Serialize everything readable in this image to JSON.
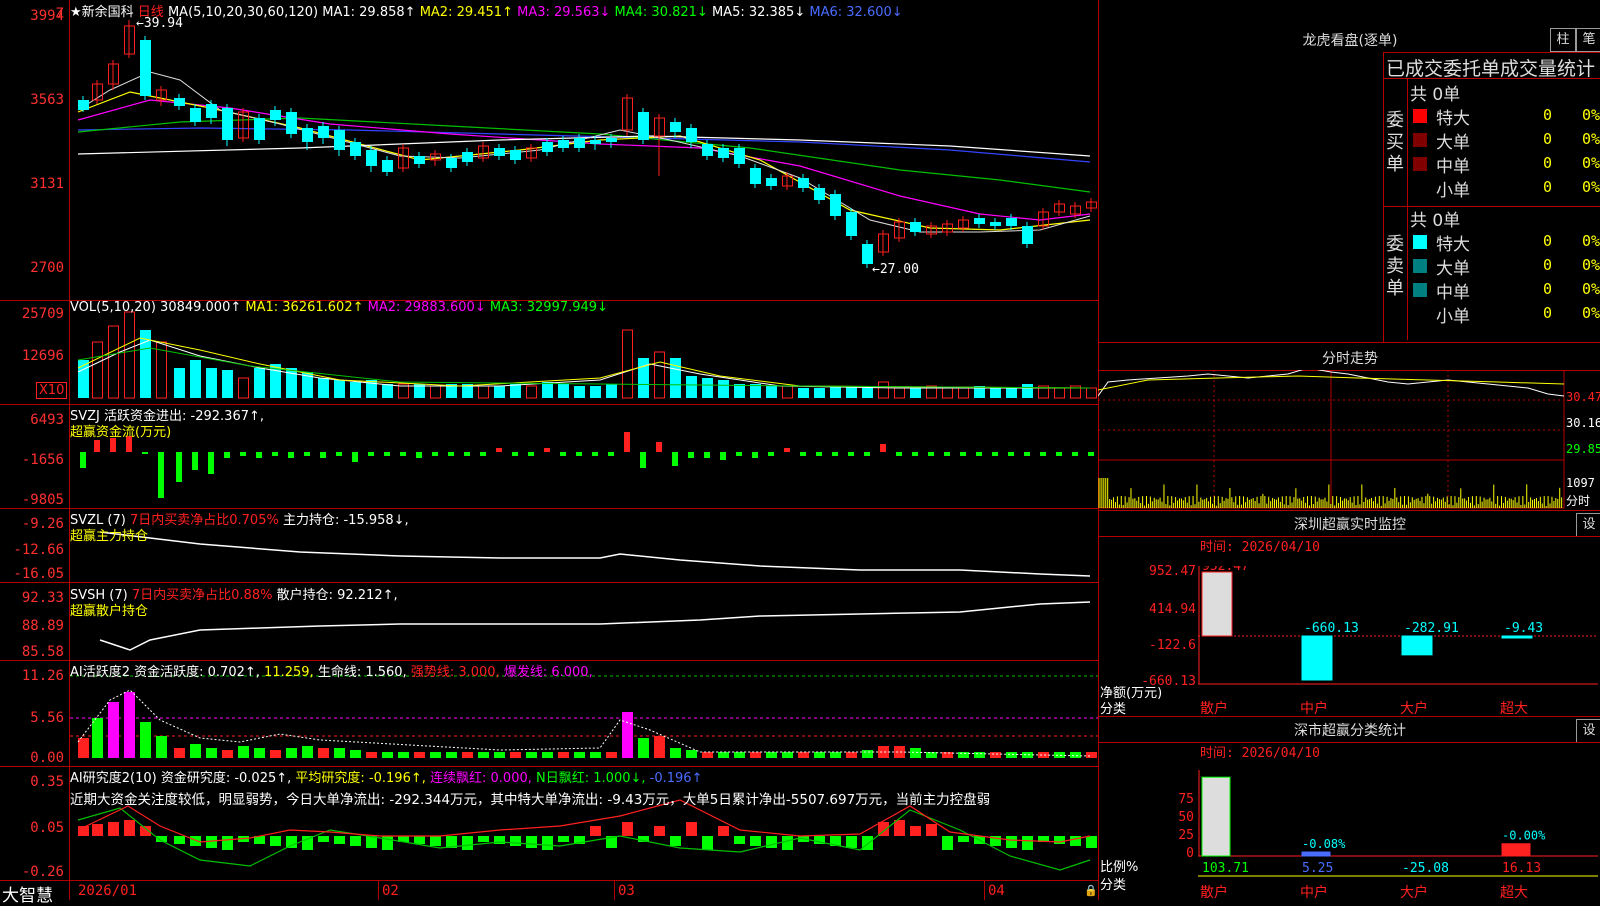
{
  "stock": {
    "name": "★新余国科",
    "period": "日线",
    "ma_label": "MA(5,10,20,30,60,120)",
    "ma1": "MA1: 29.858↑",
    "ma2": "MA2: 29.451↑",
    "ma3": "MA3: 29.563↓",
    "ma4": "MA4: 30.821↓",
    "ma5": "MA5: 32.385↓",
    "ma6": "MA6: 32.600↓",
    "high_marker": "39.94",
    "low_marker": "27.00",
    "axis": [
      "3994",
      "3563",
      "3131",
      "2700"
    ],
    "top_marker": "7"
  },
  "vol": {
    "label": "VOL(5,10,20)",
    "value": "30849.000↑",
    "ma1": "MA1: 36261.602↑",
    "ma2": "MA2: 29883.600↓",
    "ma3": "MA3: 32997.949↓",
    "axis": [
      "25709",
      "12696"
    ],
    "unit": "X10"
  },
  "svzj": {
    "label": "SVZJ",
    "value": "活跃资金进出: -292.367↑,",
    "subtitle": "超赢资金流(万元)",
    "axis": [
      "6493",
      "-1656",
      "-9805"
    ]
  },
  "svzl": {
    "label": "SVZL (7)",
    "ratio": "7日内买卖净占比0.705%",
    "value": "主力持仓: -15.958↓,",
    "subtitle": "超赢主力持仓",
    "axis": [
      "-9.26",
      "-12.66",
      "-16.05"
    ]
  },
  "svsh": {
    "label": "SVSH (7)",
    "ratio": "7日内买卖净占比0.88%",
    "value": "散户持仓: 92.212↑,",
    "subtitle": "超赢散户持仓",
    "axis": [
      "92.33",
      "88.89",
      "85.58"
    ]
  },
  "ai1": {
    "label": "AI活跃度2",
    "v1": "资金活跃度: 0.702↑,",
    "v2": "11.259,",
    "v3": "生命线: 1.560,",
    "v4": "强势线: 3.000,",
    "v5": "爆发线: 6.000,",
    "axis": [
      "11.26",
      "5.56",
      "0.00"
    ]
  },
  "ai2": {
    "label": "AI研究度2(10)",
    "v1": "资金研究度: -0.025↑,",
    "v2": "平均研究度: -0.196↑,",
    "v3": "连续飘红: 0.000,",
    "v4": "N日飘红: 1.000↓,",
    "v5": "-0.196↑",
    "note": "近期大资金关注度较低，明显弱势，今日大单净流出: -292.344万元，其中特大单净流出: -9.43万元，大单5日累计净出-5507.697万元，当前主力控盘弱",
    "axis": [
      "0.35",
      "0.05",
      "-0.26"
    ]
  },
  "xaxis": {
    "brand": "大智慧",
    "dates": [
      "2026/01",
      "02",
      "03",
      "04"
    ]
  },
  "dragon": {
    "title": "龙虎看盘(逐单)",
    "btn1": "柱",
    "btn2": "笔",
    "header": "已成交委托单成交量统计",
    "buy_side": "委买单",
    "sell_side": "委卖单",
    "buy_total": "共 0单",
    "sell_total": "共 0单",
    "buy_rows": [
      {
        "label": "特大",
        "value": "0",
        "pct": "0%",
        "color": "#ff0000"
      },
      {
        "label": "大单",
        "value": "0",
        "pct": "0%",
        "color": "#800000"
      },
      {
        "label": "中单",
        "value": "0",
        "pct": "0%",
        "color": "#800000"
      },
      {
        "label": "小单",
        "value": "0",
        "pct": "0%",
        "color": ""
      }
    ],
    "sell_rows": [
      {
        "label": "特大",
        "value": "0",
        "pct": "0%",
        "color": "#00ffff"
      },
      {
        "label": "大单",
        "value": "0",
        "pct": "0%",
        "color": "#008080"
      },
      {
        "label": "中单",
        "value": "0",
        "pct": "0%",
        "color": "#008080"
      },
      {
        "label": "小单",
        "value": "0",
        "pct": "0%",
        "color": ""
      }
    ]
  },
  "intraday": {
    "title": "分时走势",
    "axis": [
      "30.47",
      "30.16",
      "29.85"
    ],
    "vol_axis": "1097",
    "vol_label": "分时"
  },
  "monitor": {
    "title": "深圳超赢实时监控",
    "btn": "设",
    "time": "时间: 2026/04/10",
    "axis": [
      "952.47",
      "414.94",
      "-122.6",
      "-660.13"
    ],
    "ylabel": "净额(万元)",
    "xlabel": "分类",
    "chart_data": {
      "type": "bar",
      "categories": [
        "散户",
        "中户",
        "大户",
        "超大"
      ],
      "values": [
        952.47,
        -660.13,
        -282.91,
        -9.43
      ],
      "labels": [
        "952.47",
        "-660.13",
        "-282.91",
        "-9.43"
      ]
    }
  },
  "stats": {
    "title": "深市超赢分类统计",
    "btn": "设",
    "time": "时间: 2026/04/10",
    "axis": [
      "75",
      "50",
      "25",
      "0"
    ],
    "ylabel": "比例%",
    "xlabel": "分类",
    "chart_data": {
      "type": "bar",
      "categories": [
        "散户",
        "中户",
        "大户",
        "超大"
      ],
      "values": [
        103.71,
        5.25,
        -25.08,
        16.13
      ],
      "labels": [
        "103.71",
        "5.25",
        "-25.08",
        "16.13"
      ],
      "top_labels": [
        "",
        "-0.08%",
        "",
        "-0.00%"
      ]
    }
  }
}
